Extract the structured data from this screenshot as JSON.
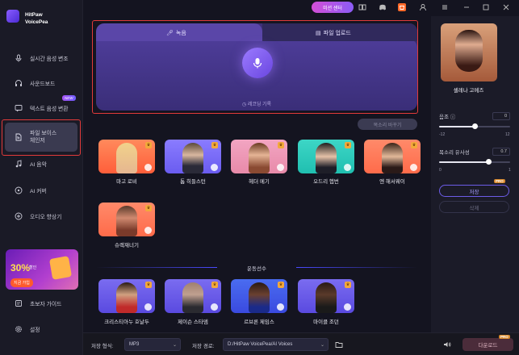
{
  "app": {
    "name_line1": "HitPaw",
    "name_line2": "VoicePea"
  },
  "topbar": {
    "mission_label": "미션 센터"
  },
  "sidebar": {
    "items": [
      {
        "label": "실시간 음성 변조"
      },
      {
        "label": "사운드보드"
      },
      {
        "label": "텍스트 음성 변환"
      },
      {
        "label": "파일 보이스 체인저"
      },
      {
        "label": "AI 음악"
      },
      {
        "label": "AI 커버"
      },
      {
        "label": "오디오 향상기"
      },
      {
        "label": "초보자 가이드"
      },
      {
        "label": "설정"
      }
    ],
    "new_badge": "NEW",
    "promo": {
      "line1": "",
      "discount": "30%",
      "discount_suffix": "할인",
      "cta": "지금 가입"
    }
  },
  "recorder": {
    "tab_record": "녹음",
    "tab_upload": "파일 업로드",
    "history": "레코딩 기록"
  },
  "select_button": "목소리 바꾸기",
  "voices": [
    {
      "name": "마고 로비"
    },
    {
      "name": "톰 히들스턴"
    },
    {
      "name": "헤더 메기"
    },
    {
      "name": "오드리 헵번"
    },
    {
      "name": "엔 해서웨이"
    },
    {
      "name": "슈렉재너기"
    }
  ],
  "section": {
    "title": "운동선수"
  },
  "athletes": [
    {
      "name": "크리스티아누 호날두"
    },
    {
      "name": "제이슨 스타뎀"
    },
    {
      "name": "르브론 제임스"
    },
    {
      "name": "마이클 조던"
    }
  ],
  "right_panel": {
    "voice_name": "셀레나 고메즈",
    "pitch_label": "음조",
    "pitch_value": "0",
    "pitch_min": "-12",
    "pitch_max": "12",
    "similarity_label": "목소리 유사성",
    "similarity_value": "0.7",
    "sim_min": "0",
    "sim_max": "1",
    "pitch_fraction": 0.5,
    "similarity_fraction": 0.7,
    "save_label": "저장",
    "delete_label": "삭제",
    "pro_label": "PRO"
  },
  "bottombar": {
    "format_label": "저장 형식:",
    "format_value": "MP3",
    "path_label": "저장 경로:",
    "path_value": "D:/HitPaw VoicePea/AI Voices",
    "convert_label": "다운로드",
    "pro_label": "PRO"
  }
}
